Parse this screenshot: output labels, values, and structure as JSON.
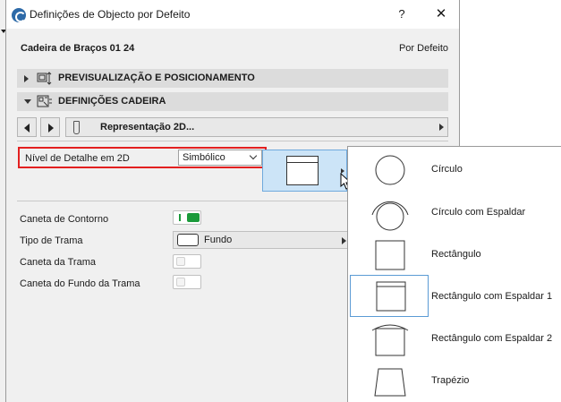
{
  "window": {
    "title": "Definições de Objecto por Defeito",
    "help_label": "?",
    "close_label": "✕"
  },
  "header": {
    "object_name": "Cadeira de Braços 01 24",
    "default_label": "Por Defeito"
  },
  "sections": [
    {
      "label": "PREVISUALIZAÇÃO E POSICIONAMENTO",
      "expanded": false,
      "icon": "preview-position-icon"
    },
    {
      "label": "DEFINIÇÕES CADEIRA",
      "expanded": true,
      "icon": "chair-settings-icon"
    }
  ],
  "navigator": {
    "representation_label": "Representação 2D..."
  },
  "detail_level": {
    "label": "Nível de Detalhe em 2D",
    "value": "Simbólico"
  },
  "properties": {
    "contour_pen_label": "Caneta de Contorno",
    "fill_type_label": "Tipo de Trama",
    "fill_type_value": "Fundo",
    "fill_pen_label": "Caneta da Trama",
    "fill_bg_pen_label": "Caneta do Fundo da Trama"
  },
  "shape_options": [
    {
      "label": "Círculo",
      "icon": "circle-shape-icon",
      "selected": false
    },
    {
      "label": "Círculo com Espaldar",
      "icon": "circle-backrest-shape-icon",
      "selected": false
    },
    {
      "label": "Rectângulo",
      "icon": "rectangle-shape-icon",
      "selected": false
    },
    {
      "label": "Rectângulo com Espaldar 1",
      "icon": "rectangle-backrest-1-shape-icon",
      "selected": true
    },
    {
      "label": "Rectângulo com Espaldar 2",
      "icon": "rectangle-backrest-2-shape-icon",
      "selected": false
    },
    {
      "label": "Trapézio",
      "icon": "trapezoid-shape-icon",
      "selected": false
    }
  ],
  "colors": {
    "highlight_border": "#e32020",
    "toggle_on": "#1a9a3a",
    "selection_blue": "#cce4f7"
  }
}
